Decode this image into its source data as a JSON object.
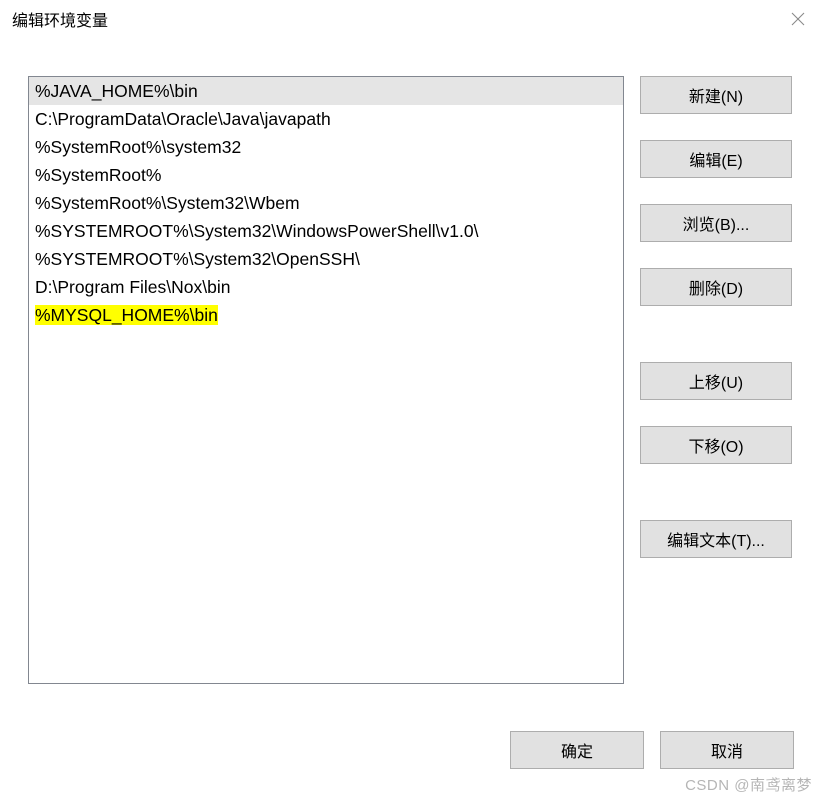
{
  "titlebar": {
    "title": "编辑环境变量"
  },
  "list": {
    "items": [
      {
        "text": "%JAVA_HOME%\\bin",
        "selected": true,
        "highlighted": false
      },
      {
        "text": "C:\\ProgramData\\Oracle\\Java\\javapath",
        "selected": false,
        "highlighted": false
      },
      {
        "text": "%SystemRoot%\\system32",
        "selected": false,
        "highlighted": false
      },
      {
        "text": "%SystemRoot%",
        "selected": false,
        "highlighted": false
      },
      {
        "text": "%SystemRoot%\\System32\\Wbem",
        "selected": false,
        "highlighted": false
      },
      {
        "text": "%SYSTEMROOT%\\System32\\WindowsPowerShell\\v1.0\\",
        "selected": false,
        "highlighted": false
      },
      {
        "text": "%SYSTEMROOT%\\System32\\OpenSSH\\",
        "selected": false,
        "highlighted": false
      },
      {
        "text": "D:\\Program Files\\Nox\\bin",
        "selected": false,
        "highlighted": false
      },
      {
        "text": "%MYSQL_HOME%\\bin",
        "selected": false,
        "highlighted": true
      }
    ]
  },
  "buttons": {
    "new": "新建(N)",
    "edit": "编辑(E)",
    "browse": "浏览(B)...",
    "delete": "删除(D)",
    "up": "上移(U)",
    "down": "下移(O)",
    "edit_text": "编辑文本(T)..."
  },
  "footer": {
    "ok": "确定",
    "cancel": "取消"
  },
  "watermark": "CSDN @南鸢离梦"
}
